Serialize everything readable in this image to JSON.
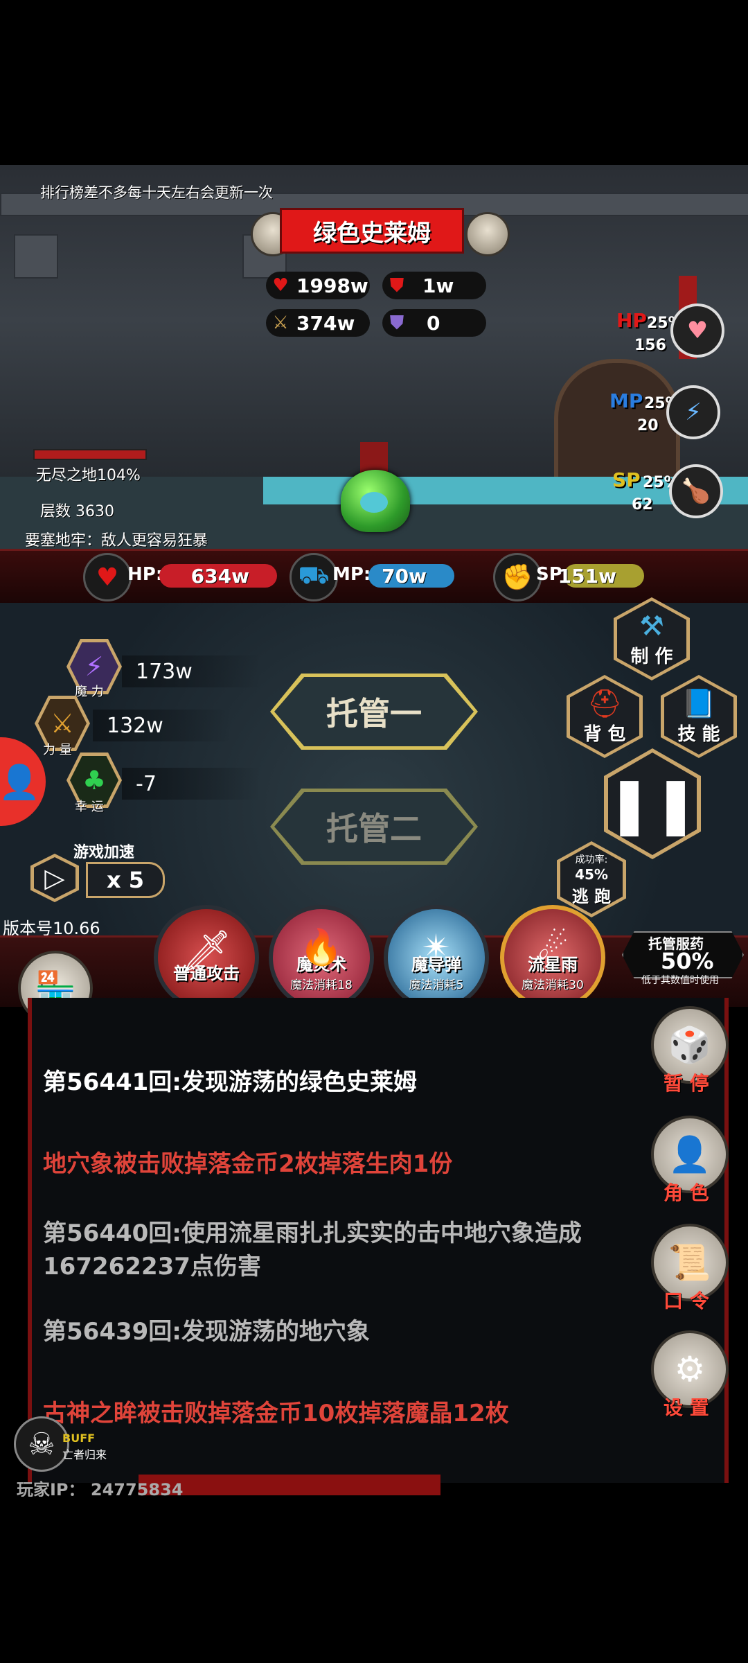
{
  "notice": "排行榜差不多每十天左右会更新一次",
  "monster": {
    "name": "绿色史莱姆",
    "hp": "1998w",
    "defense": "1w",
    "attack": "374w",
    "magic_def": "0"
  },
  "potions": {
    "hp": {
      "label": "HP",
      "pct": "25%",
      "count": "156"
    },
    "mp": {
      "label": "MP",
      "pct": "25%",
      "count": "20"
    },
    "sp": {
      "label": "SP",
      "pct": "25%",
      "count": "62"
    }
  },
  "zone": {
    "name": "无尽之地104%",
    "layer": "层数 3630",
    "desc": "要塞地牢：敌人更容易狂暴"
  },
  "player_bars": {
    "hp": {
      "label": "HP:",
      "value": "634w",
      "fill": 0.85
    },
    "mp": {
      "label": "MP:",
      "value": "70w",
      "fill": 0.8
    },
    "sp": {
      "label": "SP:",
      "value": "151w",
      "fill": 0.8
    }
  },
  "attributes": [
    {
      "label": "魔 力",
      "value": "173w"
    },
    {
      "label": "力 量",
      "value": "132w"
    },
    {
      "label": "幸 运",
      "value": "-7"
    }
  ],
  "auto": {
    "one": "托管一",
    "two": "托管二"
  },
  "side_buttons": {
    "craft": "制 作",
    "bag": "背 包",
    "skill": "技 能"
  },
  "escape": {
    "rate_label": "成功率:",
    "rate": "45%",
    "label": "逃 跑"
  },
  "speed": {
    "title": "游戏加速",
    "value": "x 5"
  },
  "version": "版本号10.66",
  "shop": "商 铺",
  "skills": [
    {
      "name": "普通攻击",
      "cost": ""
    },
    {
      "name": "魔炎术",
      "cost": "魔法消耗18"
    },
    {
      "name": "魔导弹",
      "cost": "魔法消耗5"
    },
    {
      "name": "流星雨",
      "cost": "魔法消耗30"
    }
  ],
  "potion_auto": {
    "title": "托管服药",
    "pct": "50%",
    "note": "低于其数值时使用"
  },
  "log": [
    {
      "text": "第56441回:发现游荡的绿色史莱姆",
      "color": "#ffffff"
    },
    {
      "text": "地穴象被击败掉落金币2枚掉落生肉1份",
      "color": "#e0443a"
    },
    {
      "text": "第56440回:使用流星雨扎扎实实的击中地穴象造成167262237点伤害",
      "color": "#b9b9b9"
    },
    {
      "text": "第56439回:发现游荡的地穴象",
      "color": "#b9b9b9"
    },
    {
      "text": "古神之眸被击败掉落金币10枚掉落魔晶12枚",
      "color": "#e0443a"
    }
  ],
  "right_menu": {
    "pause": "暂 停",
    "role": "角 色",
    "code": "口 令",
    "settings": "设 置"
  },
  "buff": {
    "title": "BUFF",
    "name": "亡者归来"
  },
  "player_ip": "玩家IP： 24775834"
}
